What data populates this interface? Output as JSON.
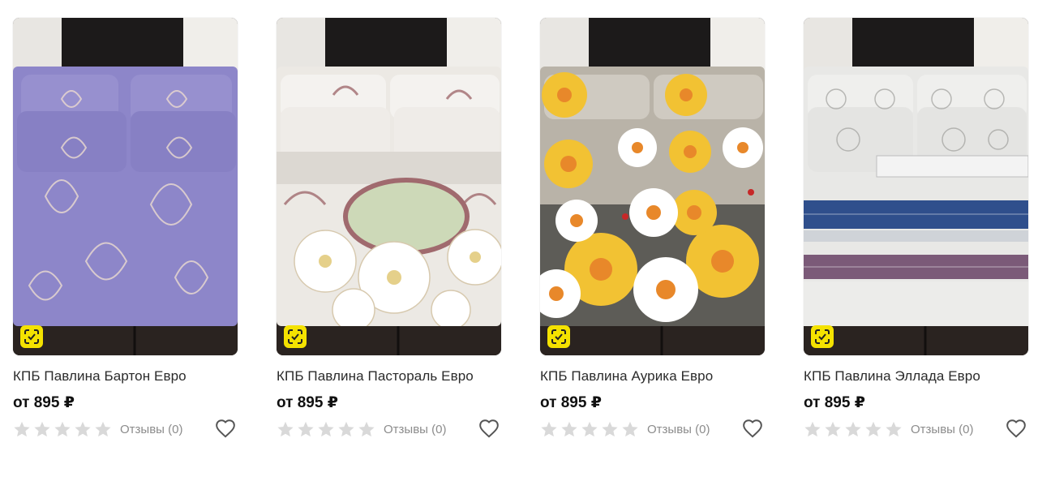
{
  "products": [
    {
      "title": "КПБ Павлина Бартон Евро",
      "price": "от 895 ₽",
      "reviews": "Отзывы (0)",
      "rating": 0,
      "image_icon": "bedding-photo-purple-paisley",
      "colors": {
        "base": "#8d86c9",
        "pattern": "#e6d6cf",
        "dark": "#6f69aa"
      }
    },
    {
      "title": "КПБ Павлина Пастораль Евро",
      "price": "от 895 ₽",
      "reviews": "Отзывы (0)",
      "rating": 0,
      "image_icon": "bedding-photo-white-flowers",
      "colors": {
        "base": "#ece9e4",
        "pattern": "#a06a6e",
        "dark": "#c9c2b8"
      }
    },
    {
      "title": "КПБ Павлина Аурика Евро",
      "price": "от 895 ₽",
      "reviews": "Отзывы (0)",
      "rating": 0,
      "image_icon": "bedding-photo-daisies",
      "colors": {
        "base": "#5d5c57",
        "pattern": "#f2c233",
        "dark": "#3d3c38"
      }
    },
    {
      "title": "КПБ Павлина Эллада Евро",
      "price": "от 895 ₽",
      "reviews": "Отзывы (0)",
      "rating": 0,
      "image_icon": "bedding-photo-greek-stripes",
      "colors": {
        "base": "#e8e8e6",
        "pattern": "#2f4f8c",
        "dark": "#7b5a78"
      }
    }
  ],
  "badge_icon": "scan-icon",
  "favorite_icon": "heart-icon",
  "star_icon": "star-icon",
  "theme": {
    "star_empty": "#d9d9d9",
    "badge": "#f4e200",
    "text_muted": "#8c8c8c"
  }
}
